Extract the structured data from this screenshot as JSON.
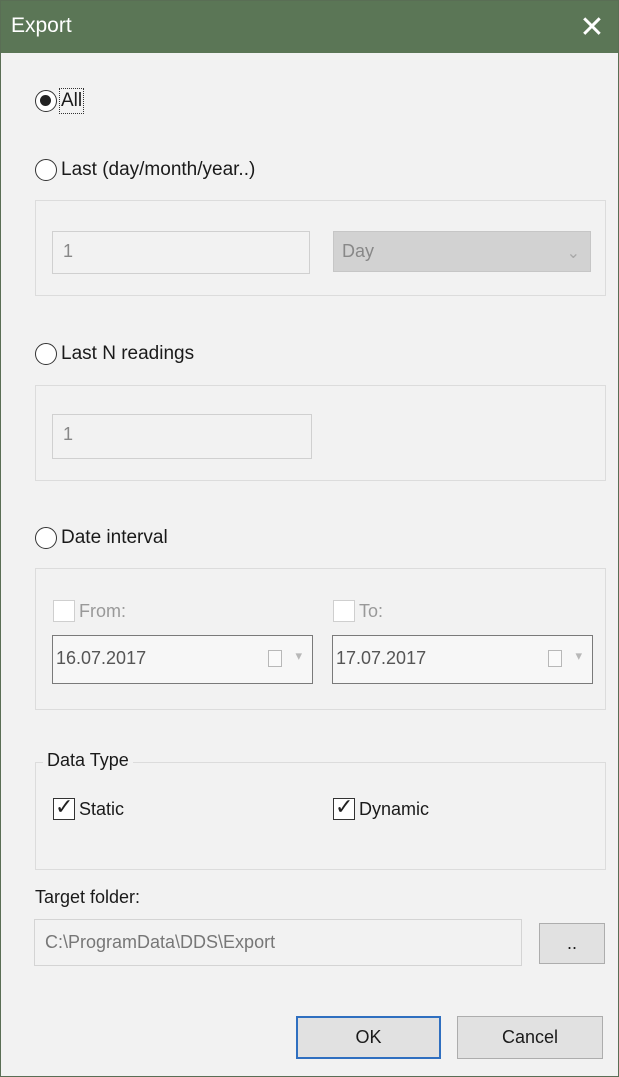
{
  "window": {
    "title": "Export",
    "close_icon": "close-icon"
  },
  "options": {
    "all": {
      "label": "All",
      "checked": true
    },
    "last_period": {
      "label": "Last (day/month/year..)",
      "checked": false,
      "count_value": "1",
      "unit_value": "Day"
    },
    "last_n": {
      "label": "Last N readings",
      "checked": false,
      "count_value": "1"
    },
    "date_interval": {
      "label": "Date interval",
      "checked": false,
      "from_label": "From:",
      "from_checked": false,
      "from_value": "16.07.2017",
      "to_label": "To:",
      "to_checked": false,
      "to_value": "17.07.2017"
    }
  },
  "data_type": {
    "legend": "Data Type",
    "static": {
      "label": "Static",
      "checked": true
    },
    "dynamic": {
      "label": "Dynamic",
      "checked": true
    }
  },
  "target": {
    "label": "Target folder:",
    "path": "C:\\ProgramData\\DDS\\Export",
    "browse_label": ".."
  },
  "buttons": {
    "ok": "OK",
    "cancel": "Cancel"
  },
  "colors": {
    "titlebar": "#5b7656",
    "default_button_border": "#2f6fc0"
  }
}
